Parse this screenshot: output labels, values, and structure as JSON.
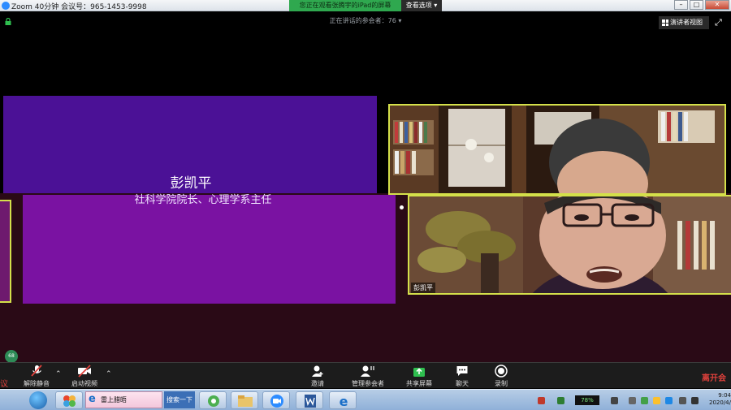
{
  "window": {
    "title": "Zoom 40分钟 会议号：965-1453-9998",
    "share_banner": "您正在观看张腾宇的iPad的屏幕",
    "view_options": "查看选项",
    "win_controls": [
      "–",
      "□",
      "✕"
    ]
  },
  "top_bar": {
    "speaker_label": "正在讲话的参会者：76",
    "speaker_view": "演讲者视图"
  },
  "stage": {
    "slide_name": "彭凯平",
    "slide_subtitle": "社科学院院长、心理学系主任",
    "video_participant_name": "彭凯平"
  },
  "toolbar": {
    "unmute": "解除静音",
    "start_video": "启动视频",
    "invite": "邀请",
    "participants": "管理参会者",
    "share": "共享屏幕",
    "chat": "聊天",
    "record": "录制",
    "end": "离开会",
    "left_edge": "议",
    "badge": "68"
  },
  "taskbar": {
    "search_placeholder": "雷上腊晤",
    "search_button": "搜索一下",
    "battery": "78%",
    "clock_time": "9:04",
    "clock_date": "2020/4/"
  },
  "colors": {
    "slide_top": "#4b1196",
    "slide_bottom": "#7a12a2",
    "active_border": "#d4e04a",
    "share_banner": "#2fa84f",
    "end_red": "#e0413c"
  }
}
